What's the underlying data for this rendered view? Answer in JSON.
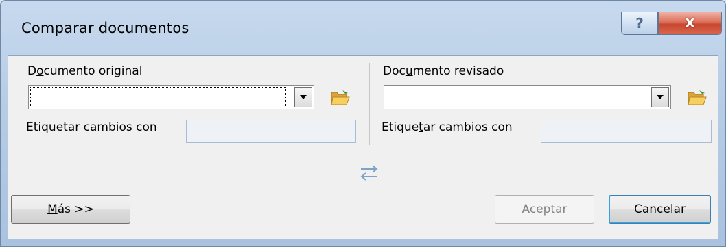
{
  "window": {
    "title": "Comparar documentos",
    "help_label": "?",
    "close_label": "X"
  },
  "original": {
    "label_before": "D",
    "label_accel": "o",
    "label_after": "cumento original",
    "value": "",
    "tag_label": "Etiquetar cambios con",
    "tag_value": ""
  },
  "revised": {
    "label_before": "Doc",
    "label_accel": "u",
    "label_after": "mento revisado",
    "value": "",
    "tag_label_before": "Etique",
    "tag_label_accel": "t",
    "tag_label_after": "ar cambios con",
    "tag_value": ""
  },
  "buttons": {
    "more_accel": "M",
    "more_rest": "ás >>",
    "ok": "Aceptar",
    "cancel": "Cancelar"
  },
  "icons": {
    "browse": "open-folder-icon",
    "swap": "swap-arrows-icon",
    "dropdown": "chevron-down-icon"
  },
  "colors": {
    "close_button": "#c8472f",
    "swap_arrows": "#7da4c8"
  }
}
